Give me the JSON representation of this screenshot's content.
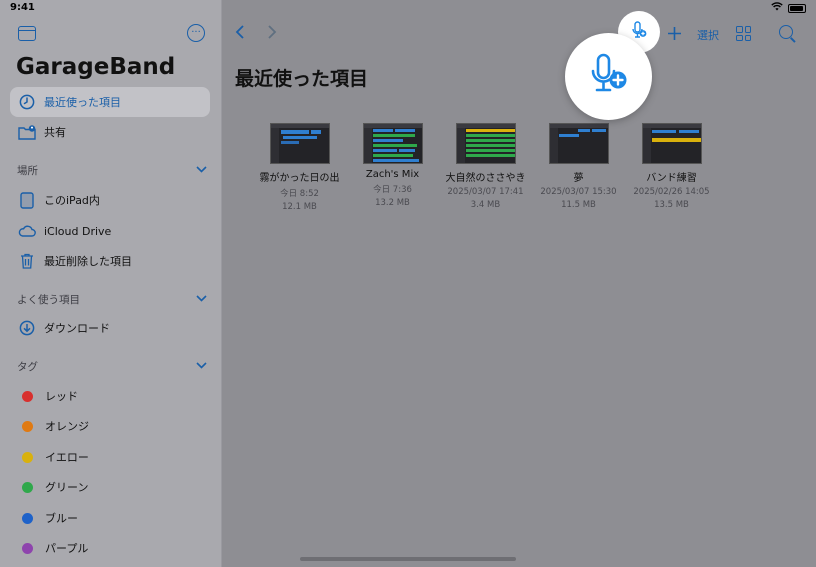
{
  "status_bar": {
    "time": "9:41"
  },
  "sidebar": {
    "app_title": "GarageBand",
    "items": [
      {
        "label": "最近使った項目",
        "icon": "clock-icon",
        "selected": true
      },
      {
        "label": "共有",
        "icon": "shared-folder-icon"
      }
    ],
    "sections": [
      {
        "title": "場所",
        "items": [
          {
            "label": "このiPad内",
            "icon": "ipad-icon"
          },
          {
            "label": "iCloud Drive",
            "icon": "cloud-icon"
          },
          {
            "label": "最近削除した項目",
            "icon": "trash-icon"
          }
        ]
      },
      {
        "title": "よく使う項目",
        "items": [
          {
            "label": "ダウンロード",
            "icon": "download-icon"
          }
        ]
      },
      {
        "title": "タグ",
        "items": [
          {
            "label": "レッド",
            "color": "#d8302e"
          },
          {
            "label": "オレンジ",
            "color": "#e07a12"
          },
          {
            "label": "イエロー",
            "color": "#d9b10d"
          },
          {
            "label": "グリーン",
            "color": "#2fa84b"
          },
          {
            "label": "ブルー",
            "color": "#1e62c9"
          },
          {
            "label": "パープル",
            "color": "#8e44ad"
          }
        ]
      }
    ]
  },
  "toolbar": {
    "select_label": "選択"
  },
  "main": {
    "title": "最近使った項目",
    "files": [
      {
        "name": "霧がかった日の出",
        "date": "今日 8:52",
        "size": "12.1 MB",
        "theme": "blue"
      },
      {
        "name": "Zach's Mix",
        "date": "今日 7:36",
        "size": "13.2 MB",
        "theme": "mixed"
      },
      {
        "name": "大自然のささやき",
        "date": "2025/03/07 17:41",
        "size": "3.4 MB",
        "theme": "green"
      },
      {
        "name": "夢",
        "date": "2025/03/07 15:30",
        "size": "11.5 MB",
        "theme": "blue-sparse"
      },
      {
        "name": "バンド練習",
        "date": "2025/02/26 14:05",
        "size": "13.5 MB",
        "theme": "yellow"
      }
    ]
  },
  "colors": {
    "accent": "#1a5fa8",
    "highlight_mic": "#1e88e5"
  }
}
